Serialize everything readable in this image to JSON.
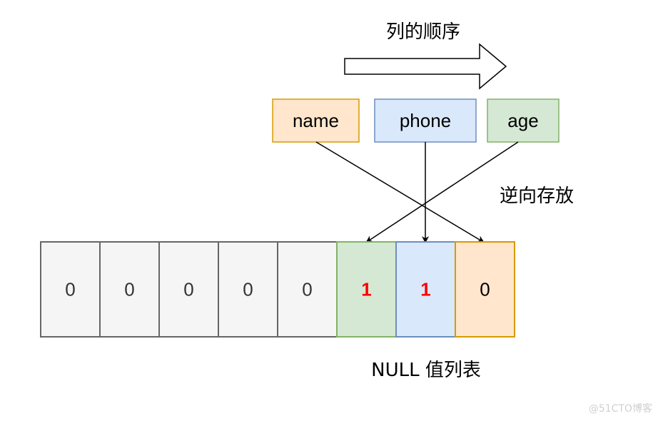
{
  "title_order": "列的顺序",
  "label_reverse": "逆向存放",
  "label_null_list": "NULL 值列表",
  "watermark": "@51CTO博客",
  "columns": [
    {
      "name": "name",
      "fill": "#ffe6cc",
      "stroke": "#d79b00"
    },
    {
      "name": "phone",
      "fill": "#dae8fc",
      "stroke": "#6c8ebf"
    },
    {
      "name": "age",
      "fill": "#d5e8d4",
      "stroke": "#82b366"
    }
  ],
  "null_bits": [
    {
      "value": "0",
      "fill": "#f5f5f5",
      "stroke": "#666666",
      "text_color": "#333333",
      "bold": false
    },
    {
      "value": "0",
      "fill": "#f5f5f5",
      "stroke": "#666666",
      "text_color": "#333333",
      "bold": false
    },
    {
      "value": "0",
      "fill": "#f5f5f5",
      "stroke": "#666666",
      "text_color": "#333333",
      "bold": false
    },
    {
      "value": "0",
      "fill": "#f5f5f5",
      "stroke": "#666666",
      "text_color": "#333333",
      "bold": false
    },
    {
      "value": "0",
      "fill": "#f5f5f5",
      "stroke": "#666666",
      "text_color": "#333333",
      "bold": false
    },
    {
      "value": "1",
      "fill": "#d5e8d4",
      "stroke": "#82b366",
      "text_color": "#ff0000",
      "bold": true,
      "maps_to": "age"
    },
    {
      "value": "1",
      "fill": "#dae8fc",
      "stroke": "#6c8ebf",
      "text_color": "#ff0000",
      "bold": true,
      "maps_to": "phone"
    },
    {
      "value": "0",
      "fill": "#ffe6cc",
      "stroke": "#d79b00",
      "text_color": "#000000",
      "bold": false,
      "maps_to": "name"
    }
  ]
}
